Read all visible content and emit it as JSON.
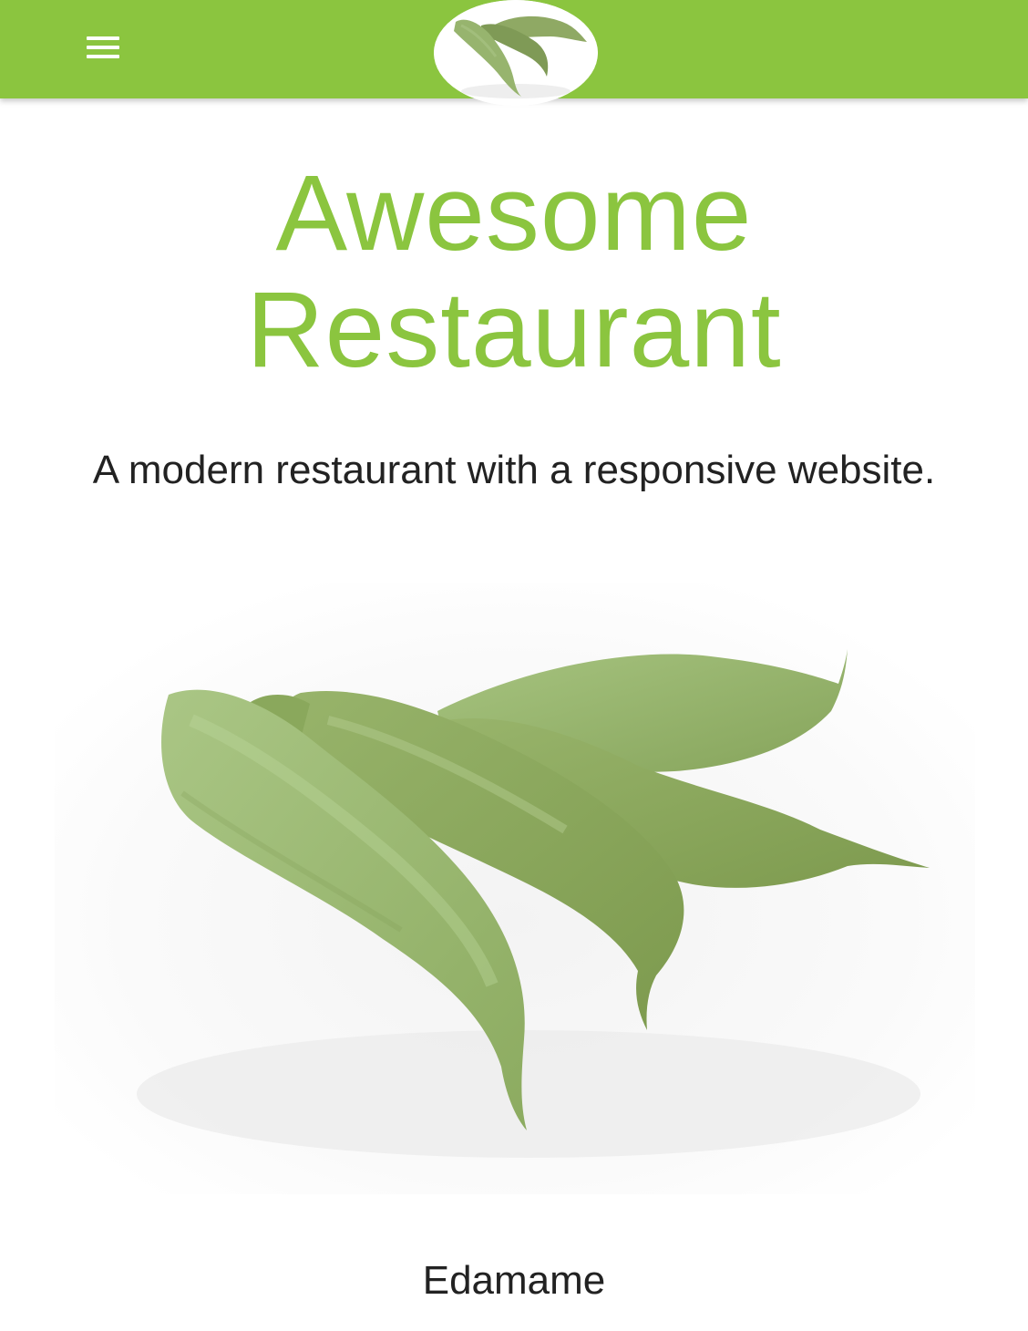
{
  "header": {
    "menu_icon": "hamburger-menu-icon",
    "logo_icon": "edamame-pods-logo"
  },
  "hero": {
    "title_line1": "Awesome",
    "title_line2": "Restaurant",
    "tagline": "A modern restaurant with a responsive website."
  },
  "featured": {
    "image_subject": "edamame-pods",
    "caption": "Edamame"
  },
  "colors": {
    "brand_green": "#8bc53f",
    "text_dark": "#222222",
    "background": "#ffffff"
  }
}
